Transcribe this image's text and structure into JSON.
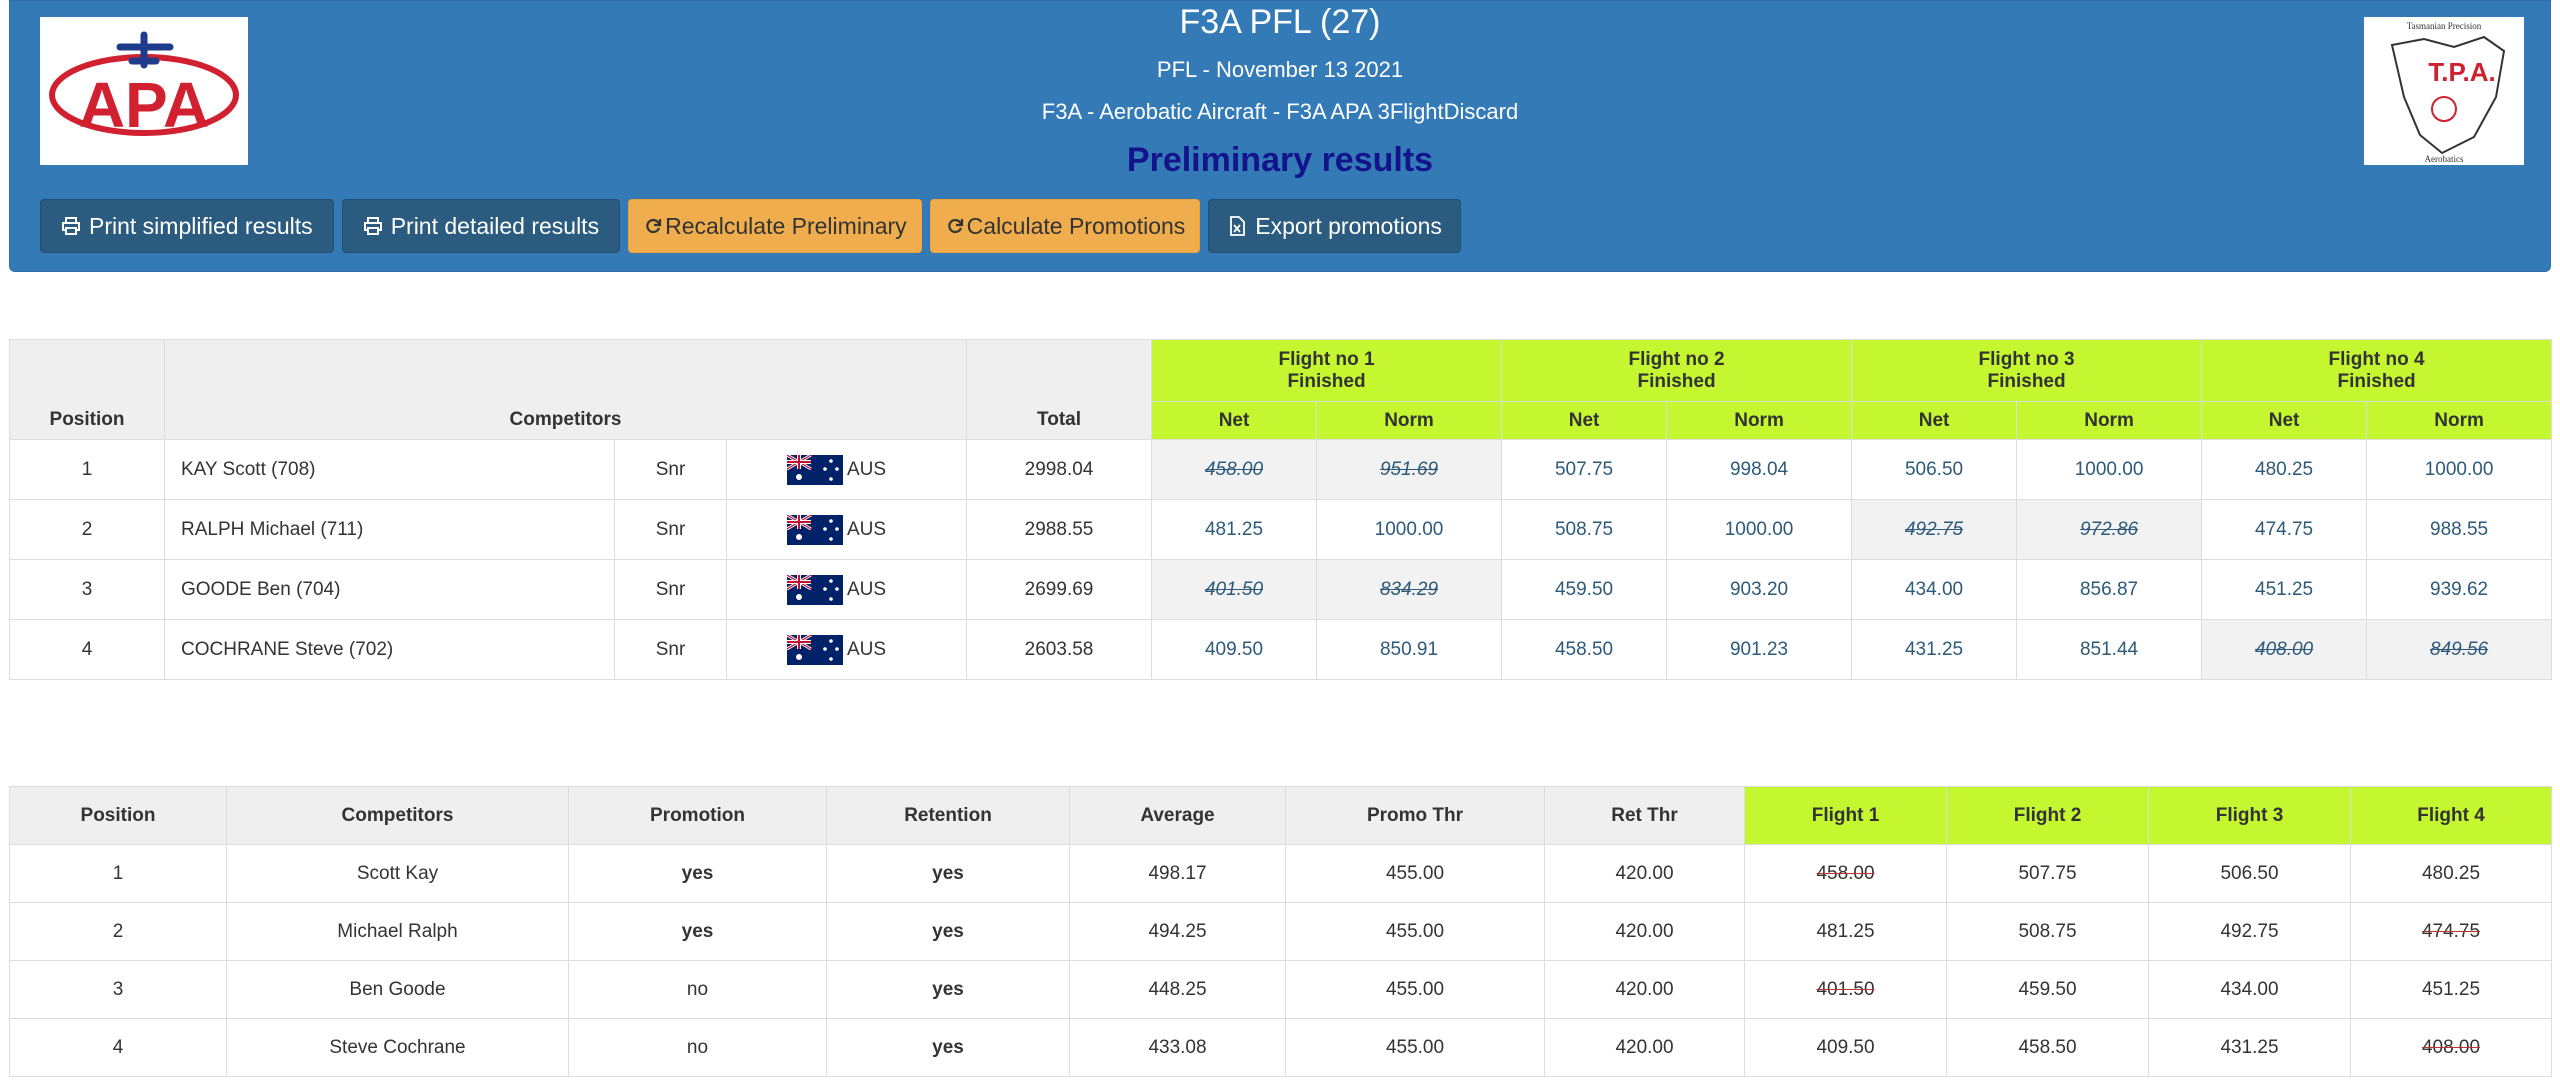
{
  "header": {
    "title": "F3A PFL (27)",
    "subtitle": "PFL - November 13 2021",
    "class_line": "F3A - Aerobatic Aircraft - F3A APA 3FlightDiscard",
    "status": "Preliminary results",
    "left_logo_text": "APA",
    "right_logo": {
      "top": "Tasmanian Precision",
      "main": "T.P.A.",
      "bottom": "Aerobatics"
    }
  },
  "buttons": {
    "print_simplified": "Print simplified results",
    "print_detailed": "Print detailed results",
    "recalc": "Recalculate Preliminary",
    "calc_promo": "Calculate Promotions",
    "export": "Export promotions"
  },
  "results": {
    "headers": {
      "position": "Position",
      "competitors": "Competitors",
      "total": "Total",
      "net": "Net",
      "norm": "Norm"
    },
    "flights": [
      {
        "title": "Flight no 1",
        "status": "Finished"
      },
      {
        "title": "Flight no 2",
        "status": "Finished"
      },
      {
        "title": "Flight no 3",
        "status": "Finished"
      },
      {
        "title": "Flight no 4",
        "status": "Finished"
      }
    ],
    "rows": [
      {
        "pos": "1",
        "name": "KAY Scott (708)",
        "cls": "Snr",
        "country": "AUS",
        "total": "2998.04",
        "f": [
          [
            "458.00",
            "951.69"
          ],
          [
            "507.75",
            "998.04"
          ],
          [
            "506.50",
            "1000.00"
          ],
          [
            "480.25",
            "1000.00"
          ]
        ],
        "dropped": 0
      },
      {
        "pos": "2",
        "name": "RALPH Michael (711)",
        "cls": "Snr",
        "country": "AUS",
        "total": "2988.55",
        "f": [
          [
            "481.25",
            "1000.00"
          ],
          [
            "508.75",
            "1000.00"
          ],
          [
            "492.75",
            "972.86"
          ],
          [
            "474.75",
            "988.55"
          ]
        ],
        "dropped": 2
      },
      {
        "pos": "3",
        "name": "GOODE Ben (704)",
        "cls": "Snr",
        "country": "AUS",
        "total": "2699.69",
        "f": [
          [
            "401.50",
            "834.29"
          ],
          [
            "459.50",
            "903.20"
          ],
          [
            "434.00",
            "856.87"
          ],
          [
            "451.25",
            "939.62"
          ]
        ],
        "dropped": 0
      },
      {
        "pos": "4",
        "name": "COCHRANE Steve (702)",
        "cls": "Snr",
        "country": "AUS",
        "total": "2603.58",
        "f": [
          [
            "409.50",
            "850.91"
          ],
          [
            "458.50",
            "901.23"
          ],
          [
            "431.25",
            "851.44"
          ],
          [
            "408.00",
            "849.56"
          ]
        ],
        "dropped": 3
      }
    ]
  },
  "promotions": {
    "headers": [
      "Position",
      "Competitors",
      "Promotion",
      "Retention",
      "Average",
      "Promo Thr",
      "Ret Thr",
      "Flight 1",
      "Flight 2",
      "Flight 3",
      "Flight 4"
    ],
    "rows": [
      {
        "pos": "1",
        "name": "Scott Kay",
        "promo": "yes",
        "ret": "yes",
        "avg": "498.17",
        "pthr": "455.00",
        "rthr": "420.00",
        "f": [
          "458.00",
          "507.75",
          "506.50",
          "480.25"
        ],
        "dropped": 0
      },
      {
        "pos": "2",
        "name": "Michael Ralph",
        "promo": "yes",
        "ret": "yes",
        "avg": "494.25",
        "pthr": "455.00",
        "rthr": "420.00",
        "f": [
          "481.25",
          "508.75",
          "492.75",
          "474.75"
        ],
        "dropped": 3
      },
      {
        "pos": "3",
        "name": "Ben Goode",
        "promo": "no",
        "ret": "yes",
        "avg": "448.25",
        "pthr": "455.00",
        "rthr": "420.00",
        "f": [
          "401.50",
          "459.50",
          "434.00",
          "451.25"
        ],
        "dropped": 0
      },
      {
        "pos": "4",
        "name": "Steve Cochrane",
        "promo": "no",
        "ret": "yes",
        "avg": "433.08",
        "pthr": "455.00",
        "rthr": "420.00",
        "f": [
          "409.50",
          "458.50",
          "431.25",
          "408.00"
        ],
        "dropped": 3
      }
    ]
  }
}
